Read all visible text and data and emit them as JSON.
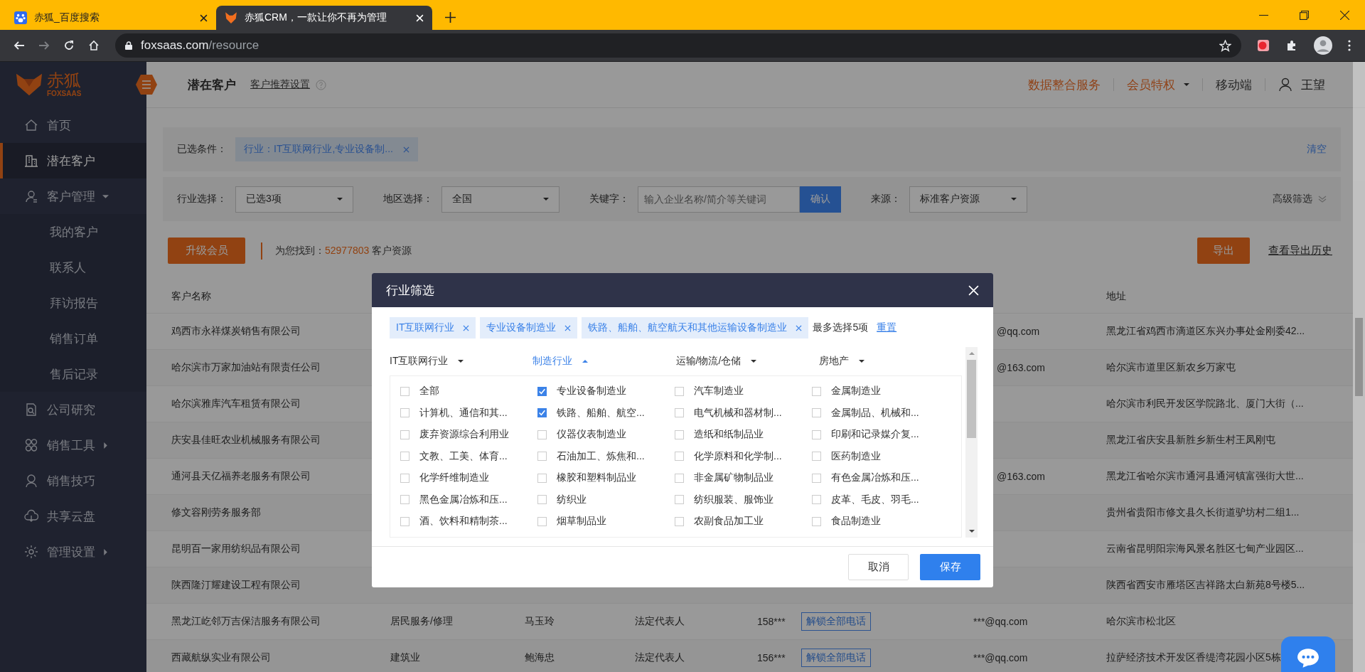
{
  "browser": {
    "tabs": [
      {
        "title": "赤狐_百度搜索",
        "selected": false
      },
      {
        "title": "赤狐CRM，一款让你不再为管理",
        "selected": true
      }
    ],
    "url_host": "foxsaas.com",
    "url_path": "/resource"
  },
  "logo": {
    "name": "赤狐",
    "tagline": "FOXSAAS"
  },
  "sidebar": {
    "items": [
      {
        "label": "首页",
        "selected": false
      },
      {
        "label": "潜在客户",
        "selected": true
      },
      {
        "label": "客户管理",
        "selected": false,
        "expanded": true,
        "children": [
          {
            "label": "我的客户",
            "selected": false
          },
          {
            "label": "联系人",
            "selected": false
          },
          {
            "label": "拜访报告",
            "selected": false
          },
          {
            "label": "销售订单",
            "selected": false
          },
          {
            "label": "售后记录",
            "selected": false
          }
        ]
      },
      {
        "label": "公司研究",
        "selected": false
      },
      {
        "label": "销售工具",
        "selected": false,
        "expanded": false
      },
      {
        "label": "销售技巧",
        "selected": false
      },
      {
        "label": "共享云盘",
        "selected": false
      },
      {
        "label": "管理设置",
        "selected": false,
        "expanded": false
      }
    ]
  },
  "header": {
    "title": "潜在客户",
    "settings_link": "客户推荐设置",
    "nav": [
      {
        "label": "数据整合服务",
        "highlight": true,
        "dropdown": false
      },
      {
        "label": "会员特权",
        "highlight": true,
        "dropdown": true
      },
      {
        "label": "移动端",
        "highlight": false,
        "dropdown": false
      }
    ],
    "user": "王望"
  },
  "conditions": {
    "label": "已选条件：",
    "tags": [
      "行业：IT互联网行业,专业设备制..."
    ],
    "clear": "清空"
  },
  "filters": {
    "industry": {
      "label": "行业选择：",
      "value": "已选3项"
    },
    "region": {
      "label": "地区选择：",
      "value": "全国"
    },
    "keyword": {
      "label": "关键字：",
      "placeholder": "输入企业名称/简介等关键词",
      "button": "确认"
    },
    "source": {
      "label": "来源：",
      "value": "标准客户资源"
    },
    "advanced": "高级筛选"
  },
  "actions": {
    "upgrade": "升级会员",
    "found_label": "为您找到：",
    "found_count": "52977803",
    "found_unit": "客户资源",
    "export": "导出",
    "export_history": "查看导出历史"
  },
  "table": {
    "columns": {
      "name": "客户名称",
      "address": "地址"
    },
    "rows": [
      {
        "name": "鸡西市永祥煤炭销售有限公司",
        "email": "@qq.com",
        "address": "黑龙江省鸡西市滴道区东兴办事处金刚委42..."
      },
      {
        "name": "哈尔滨市万家加油站有限责任公司",
        "email": "@163.com",
        "address": "哈尔滨市道里区新农乡万家屯"
      },
      {
        "name": "哈尔滨雅库汽车租赁有限公司",
        "address": "哈尔滨市利民开发区学院路北、厦门大街（..."
      },
      {
        "name": "庆安县佳旺农业机械服务有限公司",
        "address": "黑龙江省庆安县新胜乡新生村王凤刚屯"
      },
      {
        "name": "通河县天亿福养老服务有限公司",
        "email": "@163.com",
        "address": "黑龙江省哈尔滨市通河县通河镇富强街大世..."
      },
      {
        "name": "修文容刚劳务服务部",
        "address": "贵州省贵阳市修文县久长街道驴坊村二组1..."
      },
      {
        "name": "昆明百一家用纺织品有限公司",
        "address": "云南省昆明阳宗海风景名胜区七甸产业园区..."
      },
      {
        "name": "陕西隆汀耀建设工程有限公司",
        "address": "陕西省西安市雁塔区吉祥路太白新苑8号楼5..."
      },
      {
        "name": "黑龙江屹邻万吉保洁服务有限公司",
        "industry": "居民服务/修理",
        "contact": "马玉玲",
        "position": "法定代表人",
        "phone": "158***",
        "unlock": "解锁全部电话",
        "email": "***@qq.com",
        "address": "哈尔滨市松北区"
      },
      {
        "name": "西藏航纵实业有限公司",
        "industry": "建筑业",
        "contact": "鲍海忠",
        "position": "法定代表人",
        "phone": "156***",
        "unlock": "解锁全部电话",
        "email": "***@qq.com",
        "address": "拉萨经济技术开发区香缇湾花园小区5栋"
      }
    ]
  },
  "modal": {
    "title": "行业筛选",
    "tags": [
      "IT互联网行业",
      "专业设备制造业",
      "铁路、船舶、航空航天和其他运输设备制造业"
    ],
    "limit": "最多选择5项",
    "reset": "重置",
    "categories": [
      {
        "label": "IT互联网行业",
        "selected": false
      },
      {
        "label": "制造行业",
        "selected": true
      },
      {
        "label": "运输/物流/仓储",
        "selected": false
      },
      {
        "label": "房地产",
        "selected": false
      }
    ],
    "options": [
      {
        "label": "全部",
        "checked": false
      },
      {
        "label": "专业设备制造业",
        "checked": true
      },
      {
        "label": "汽车制造业",
        "checked": false
      },
      {
        "label": "金属制造业",
        "checked": false
      },
      {
        "label": "计算机、通信和其...",
        "checked": false
      },
      {
        "label": "铁路、船舶、航空...",
        "checked": true
      },
      {
        "label": "电气机械和器材制...",
        "checked": false
      },
      {
        "label": "金属制品、机械和...",
        "checked": false
      },
      {
        "label": "废弃资源综合利用业",
        "checked": false
      },
      {
        "label": "仪器仪表制造业",
        "checked": false
      },
      {
        "label": "造纸和纸制品业",
        "checked": false
      },
      {
        "label": "印刷和记录媒介复...",
        "checked": false
      },
      {
        "label": "文教、工美、体育...",
        "checked": false
      },
      {
        "label": "石油加工、炼焦和...",
        "checked": false
      },
      {
        "label": "化学原料和化学制...",
        "checked": false
      },
      {
        "label": "医药制造业",
        "checked": false
      },
      {
        "label": "化学纤维制造业",
        "checked": false
      },
      {
        "label": "橡胶和塑料制品业",
        "checked": false
      },
      {
        "label": "非金属矿物制品业",
        "checked": false
      },
      {
        "label": "有色金属冶炼和压...",
        "checked": false
      },
      {
        "label": "黑色金属冶炼和压...",
        "checked": false
      },
      {
        "label": "纺织业",
        "checked": false
      },
      {
        "label": "纺织服装、服饰业",
        "checked": false
      },
      {
        "label": "皮革、毛皮、羽毛...",
        "checked": false
      },
      {
        "label": "酒、饮料和精制茶...",
        "checked": false
      },
      {
        "label": "烟草制品业",
        "checked": false
      },
      {
        "label": "农副食品加工业",
        "checked": false
      },
      {
        "label": "食品制造业",
        "checked": false
      }
    ],
    "cancel": "取消",
    "save": "保存"
  }
}
